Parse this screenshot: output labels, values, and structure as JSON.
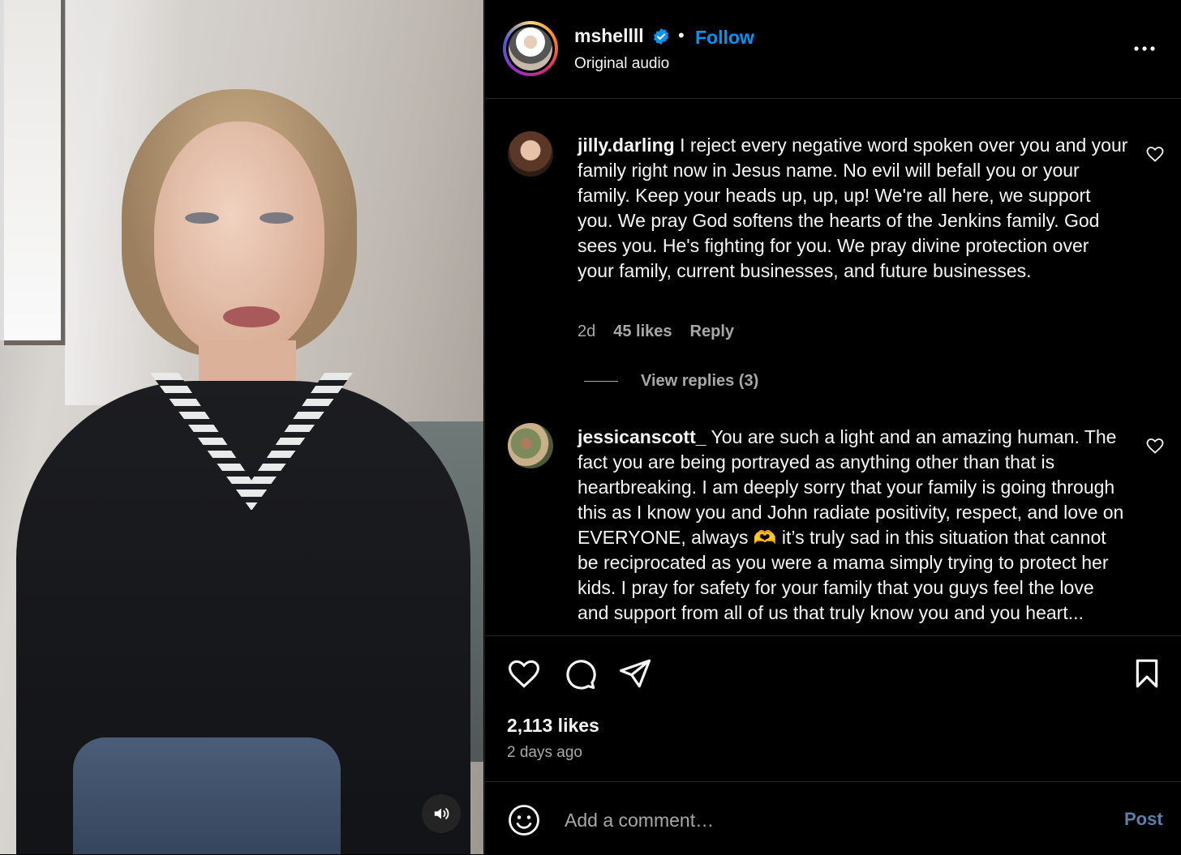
{
  "post": {
    "username": "mshellll",
    "follow_label": "Follow",
    "separator": "•",
    "audio_label": "Original audio",
    "likes_count": "2,113 likes",
    "time_ago": "2 days ago"
  },
  "comments": [
    {
      "username": "jilly.darling",
      "text": "I reject every negative word spoken over you and your family right now in Jesus name. No evil will befall you or your family. Keep your heads up, up, up! We're all here, we support you. We pray God softens the hearts of the Jenkins family. God sees you. He's fighting for you. We pray divine protection over your family, current businesses, and future businesses.",
      "age": "2d",
      "likes": "45 likes",
      "reply_label": "Reply",
      "view_replies": "View replies (3)"
    },
    {
      "username": "jessicanscott_",
      "text": "You are such a light and an amazing human. The fact you are being portrayed as anything other than that is heartbreaking. I am deeply sorry that your family is going through this as I know you and John radiate positivity, respect, and love on EVERYONE, always 🫶 it’s truly sad in this situation that cannot be reciprocated as you were a mama simply trying to protect her kids. I pray for safety for your family that you guys feel the love and support from all of us that truly know you and you heart..."
    }
  ],
  "comment_box": {
    "placeholder": "Add a comment…",
    "post_label": "Post"
  },
  "colors": {
    "accent": "#0095f6",
    "background": "#000000",
    "muted": "#a8a8a8",
    "post_disabled": "#5e7ea8"
  },
  "icons": [
    "verified-badge-icon",
    "more-icon",
    "heart-icon",
    "comment-icon",
    "share-icon",
    "bookmark-icon",
    "emoji-icon",
    "volume-icon"
  ]
}
